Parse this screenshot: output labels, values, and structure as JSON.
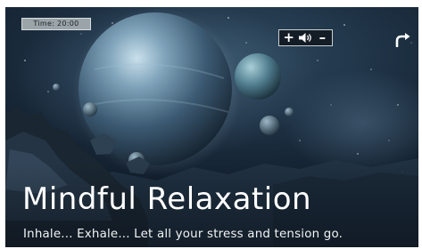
{
  "timer": {
    "text": "Time: 20:00"
  },
  "volume_controls": {
    "increase_label": "+",
    "decrease_label": "–"
  },
  "main": {
    "title": "Mindful Relaxation",
    "subtitle": "Inhale... Exhale... Let all your stress and tension go."
  },
  "icons": {
    "volume": "speaker-icon",
    "reload": "reload-arrow-icon"
  },
  "colors": {
    "text": "#ffffff",
    "timer_background": "#9aa4a9",
    "panel_background": "#141d26"
  }
}
